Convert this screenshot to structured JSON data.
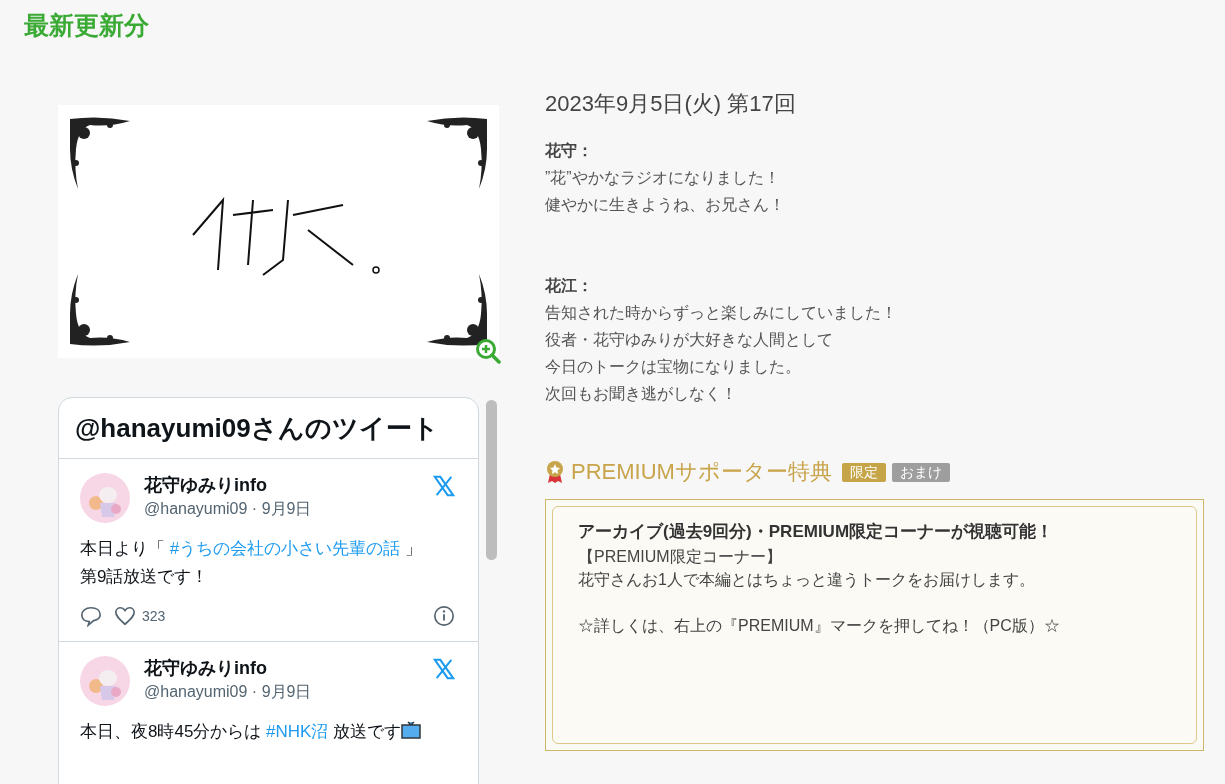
{
  "section_title": "最新更新分",
  "tweets_widget": {
    "title": "@hanayumi09さんのツイート",
    "tweets": [
      {
        "name": "花守ゆみりinfo",
        "meta": "@hanayumi09 · 9月9日",
        "lines": [
          [
            {
              "kind": "text",
              "text": "本日より「 "
            },
            {
              "kind": "hashtag",
              "text": "#うちの会社の小さい先輩の話"
            },
            {
              "kind": "text",
              "text": " 」"
            }
          ],
          [
            {
              "kind": "text",
              "text": "第9話放送です！"
            }
          ]
        ],
        "likes": "323"
      },
      {
        "name": "花守ゆみりinfo",
        "meta": "@hanayumi09 · 9月9日",
        "lines": [
          [
            {
              "kind": "text",
              "text": "本日、夜8時45分からは "
            },
            {
              "kind": "hashtag",
              "text": "#NHK沼"
            },
            {
              "kind": "text",
              "text": " 放送です"
            },
            {
              "kind": "tv"
            }
          ]
        ]
      }
    ]
  },
  "episode": {
    "date": "2023年9月5日(火) 第17回",
    "comments": [
      {
        "speaker": "花守：",
        "lines": [
          "”花”やかなラジオになりました！",
          "健やかに生きようね、お兄さん！"
        ]
      },
      {
        "speaker": "花江：",
        "lines": [
          "告知された時からずっと楽しみにしていました！",
          "役者・花守ゆみりが大好きな人間として",
          "今日のトークは宝物になりました。",
          "次回もお聞き逃がしなく！"
        ]
      }
    ]
  },
  "premium": {
    "title": "PREMIUMサポーター特典",
    "tags": [
      {
        "text": "限定",
        "color": "#c5a547"
      },
      {
        "text": "おまけ",
        "color": "#9e9e9e"
      }
    ],
    "headline": "アーカイブ(過去9回分)・PREMIUM限定コーナーが視聴可能！",
    "paragraphs": [
      [
        "【PREMIUM限定コーナー】",
        "花守さんお1人で本編とはちょっと違うトークをお届けします。"
      ],
      [
        "☆詳しくは、右上の『PREMIUM』マークを押してね！（PC版）☆"
      ]
    ]
  }
}
